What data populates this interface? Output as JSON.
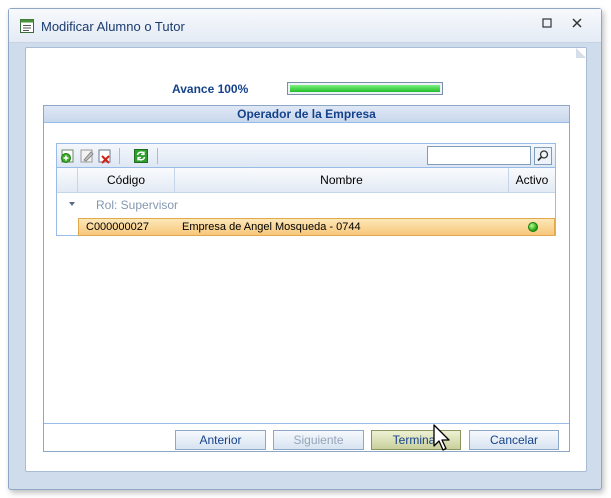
{
  "window": {
    "title": "Modificar Alumno o Tutor"
  },
  "progress": {
    "label": "Avance 100%",
    "value_percent": 100
  },
  "panel": {
    "title": "Operador de la Empresa"
  },
  "grid": {
    "search": {
      "value": "",
      "placeholder": ""
    },
    "columns": [
      "Código",
      "Nombre",
      "Activo"
    ],
    "groups": [
      {
        "label": "Rol: Supervisor",
        "rows": [
          {
            "codigo": "C000000027",
            "nombre": "Empresa de Angel Mosqueda - 0744",
            "activo": true
          }
        ]
      }
    ]
  },
  "buttons": {
    "anterior": "Anterior",
    "siguiente": "Siguiente",
    "terminar": "Terminar",
    "cancelar": "Cancelar"
  },
  "colors": {
    "accent": "#15428b",
    "progress_fill": "#1fbe2a",
    "row_selected": "#f7c77a"
  }
}
